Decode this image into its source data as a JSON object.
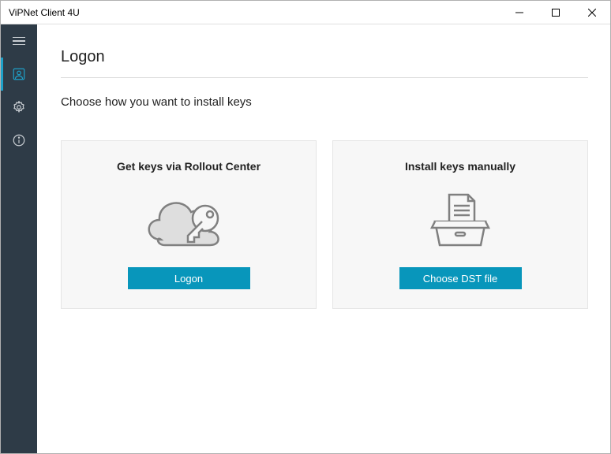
{
  "window": {
    "title": "ViPNet Client 4U"
  },
  "page": {
    "title": "Logon",
    "subtitle": "Choose how you want to install keys"
  },
  "cards": {
    "rollout": {
      "title": "Get keys via Rollout Center",
      "button": "Logon"
    },
    "manual": {
      "title": "Install keys manually",
      "button": "Choose DST file"
    }
  }
}
